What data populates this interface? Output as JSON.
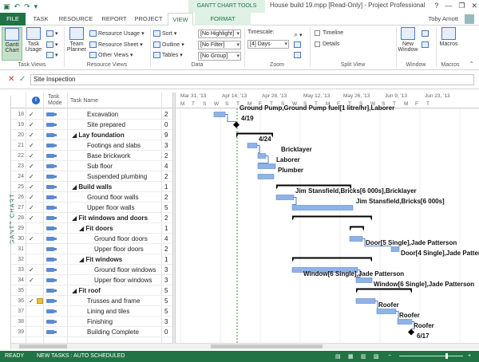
{
  "window": {
    "title": "House build 19.mpp [Read-Only] - Project Professional",
    "context_tab_group": "GANTT CHART TOOLS",
    "controls": [
      "?",
      "—",
      "❐",
      "✕"
    ]
  },
  "qat": [
    "save-icon",
    "undo-icon",
    "redo-icon",
    "customize-icon"
  ],
  "tabs": [
    "FILE",
    "TASK",
    "RESOURCE",
    "REPORT",
    "PROJECT",
    "VIEW",
    "FORMAT"
  ],
  "active_tab": "VIEW",
  "user": {
    "name": "Toby Arnott"
  },
  "ribbon": {
    "task_views": {
      "label": "Task Views",
      "gantt": "Gantt Chart",
      "task_usage": "Task Usage"
    },
    "resource_views": {
      "label": "Resource Views",
      "team_planner": "Team Planner",
      "resource_usage": "Resource Usage",
      "resource_sheet": "Resource Sheet",
      "other_views": "Other Views"
    },
    "data": {
      "label": "Data",
      "sort": "Sort",
      "outline": "Outline",
      "tables": "Tables",
      "highlight": "[No Highlight]",
      "filter": "[No Filter]",
      "group": "[No Group]"
    },
    "zoom": {
      "label": "Zoom",
      "timescale": "Timescale:",
      "timescale_value": "[4] Days"
    },
    "split_view": {
      "label": "Split View",
      "timeline": "Timeline",
      "details": "Details"
    },
    "window": {
      "label": "Window",
      "new_window": "New Window"
    },
    "macros": {
      "label": "Macros",
      "macros": "Macros"
    }
  },
  "entry": {
    "value": "Site Inspection"
  },
  "side_label": "GANTT CHART",
  "table": {
    "headers": {
      "mode": "Task Mode",
      "name": "Task Name"
    },
    "rows": [
      {
        "id": "18",
        "done": "✓",
        "name": "Excavation",
        "dur": "2",
        "indent": 3,
        "summary": false
      },
      {
        "id": "19",
        "done": "✓",
        "name": "Site prepared",
        "dur": "0",
        "indent": 3,
        "summary": false
      },
      {
        "id": "20",
        "done": "✓",
        "name": "Lay foundation",
        "dur": "9",
        "indent": 2,
        "summary": true
      },
      {
        "id": "21",
        "done": "✓",
        "name": "Footings and slabs",
        "dur": "3",
        "indent": 3,
        "summary": false
      },
      {
        "id": "22",
        "done": "✓",
        "name": "Base brickwork",
        "dur": "2",
        "indent": 3,
        "summary": false
      },
      {
        "id": "23",
        "done": "✓",
        "name": "Sub floor",
        "dur": "4",
        "indent": 3,
        "summary": false
      },
      {
        "id": "24",
        "done": "✓",
        "name": "Suspended plumbing",
        "dur": "2",
        "indent": 3,
        "summary": false
      },
      {
        "id": "25",
        "done": "✓",
        "name": "Build walls",
        "dur": "1",
        "indent": 2,
        "summary": true
      },
      {
        "id": "26",
        "done": "✓",
        "name": "Ground floor walls",
        "dur": "2",
        "indent": 3,
        "summary": false
      },
      {
        "id": "27",
        "done": "✓",
        "name": "Upper floor walls",
        "dur": "5",
        "indent": 3,
        "summary": false
      },
      {
        "id": "28",
        "done": "✓",
        "name": "Fit windows and doors",
        "dur": "2",
        "indent": 2,
        "summary": true
      },
      {
        "id": "29",
        "done": "",
        "name": "Fit doors",
        "dur": "1",
        "indent": 3,
        "summary": true
      },
      {
        "id": "30",
        "done": "✓",
        "name": "Ground floor doors",
        "dur": "4",
        "indent": 4,
        "summary": false
      },
      {
        "id": "31",
        "done": "",
        "name": "Upper floor doors",
        "dur": "2",
        "indent": 4,
        "summary": false
      },
      {
        "id": "32",
        "done": "",
        "name": "Fit windows",
        "dur": "1",
        "indent": 3,
        "summary": true
      },
      {
        "id": "33",
        "done": "✓",
        "name": "Ground floor windows",
        "dur": "3",
        "indent": 4,
        "summary": false
      },
      {
        "id": "34",
        "done": "✓",
        "name": "Upper floor windows",
        "dur": "3",
        "indent": 4,
        "summary": false
      },
      {
        "id": "35",
        "done": "",
        "name": "Fit roof",
        "dur": "5",
        "indent": 2,
        "summary": true
      },
      {
        "id": "36",
        "done": "✓",
        "name": "Trusses and frame",
        "dur": "5",
        "indent": 3,
        "summary": false
      },
      {
        "id": "37",
        "done": "",
        "name": "Lining and tiles",
        "dur": "5",
        "indent": 3,
        "summary": false
      },
      {
        "id": "38",
        "done": "",
        "name": "Finishing",
        "dur": "3",
        "indent": 3,
        "summary": false
      },
      {
        "id": "39",
        "done": "",
        "name": "Building Complete",
        "dur": "0",
        "indent": 3,
        "summary": false
      }
    ]
  },
  "timescale": {
    "weeks": [
      "Mar 31, '13",
      "Apr 14, '13",
      "Apr 28, '13",
      "May 12, '13",
      "May 26, '13",
      "Jun 9, '13",
      "Jun 23, '13"
    ],
    "days": [
      "M",
      "T",
      "S",
      "W",
      "S",
      "T",
      "M",
      "F",
      "T",
      "S",
      "W",
      "S",
      "T",
      "M",
      "F",
      "T",
      "S",
      "W",
      "S",
      "T",
      "M",
      "F",
      "T"
    ]
  },
  "gantt_labels": [
    "Ground Pump,Ground Pump fuel[1 litre/hr],Laborer",
    "4/19",
    "4/24",
    "Bricklayer",
    "Laborer",
    "Plumber",
    "Jim Stansfield,Bricks[6 000s],Bricklayer",
    "Jim Stansfield,Bricks[6 000s]",
    "Door[5 Single],Jade Patterson",
    "Door[4 Single],Jade Patterson",
    "Window[6 Single],Jade Patterson",
    "Window[6 Single],Jade Patterson",
    "Roofer",
    "Roofer",
    "Roofer",
    "6/17"
  ],
  "status": {
    "ready": "READY",
    "new_tasks": "NEW TASKS : AUTO SCHEDULED"
  },
  "colors": {
    "accent": "#217346",
    "bar": "#5b8ad0",
    "summary": "#000000"
  }
}
